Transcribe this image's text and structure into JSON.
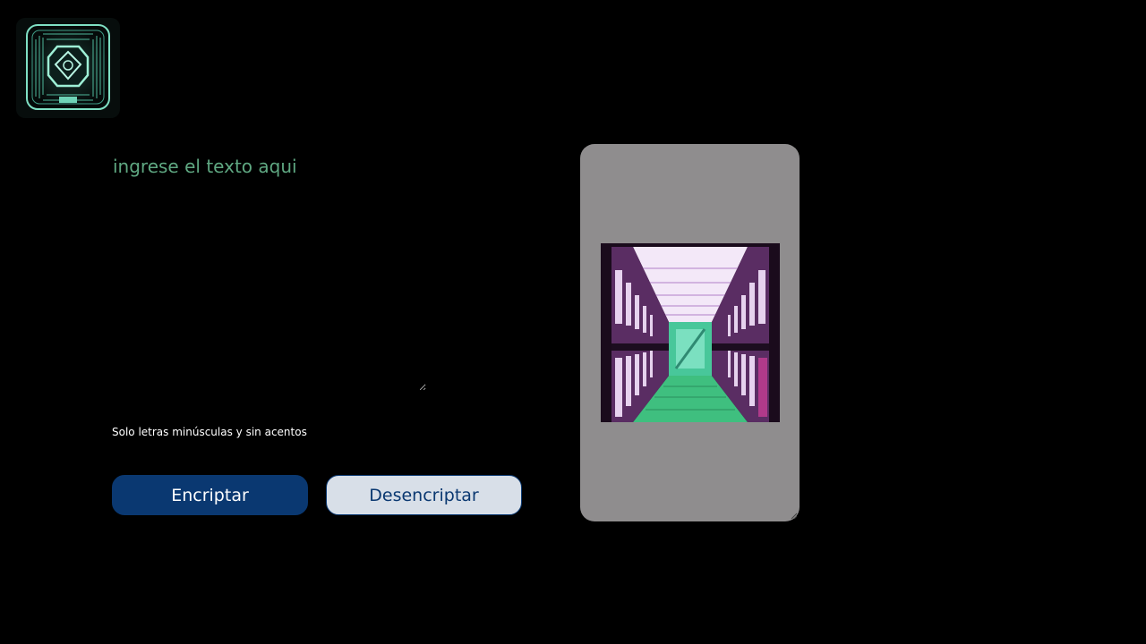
{
  "input": {
    "placeholder": "ingrese el texto aqui",
    "value": ""
  },
  "hint": {
    "text": "Solo letras minúsculas y sin acentos"
  },
  "buttons": {
    "encrypt_label": "Encriptar",
    "decrypt_label": "Desencriptar"
  },
  "output": {
    "illustration": "server-room-illustration"
  },
  "colors": {
    "background": "#000000",
    "accent": "#0a3871",
    "secondary_button": "#d8dfe8",
    "placeholder": "#5fa882",
    "panel": "#8f8d8e"
  },
  "icons": {
    "logo": "circuit-chip-logo-icon"
  }
}
